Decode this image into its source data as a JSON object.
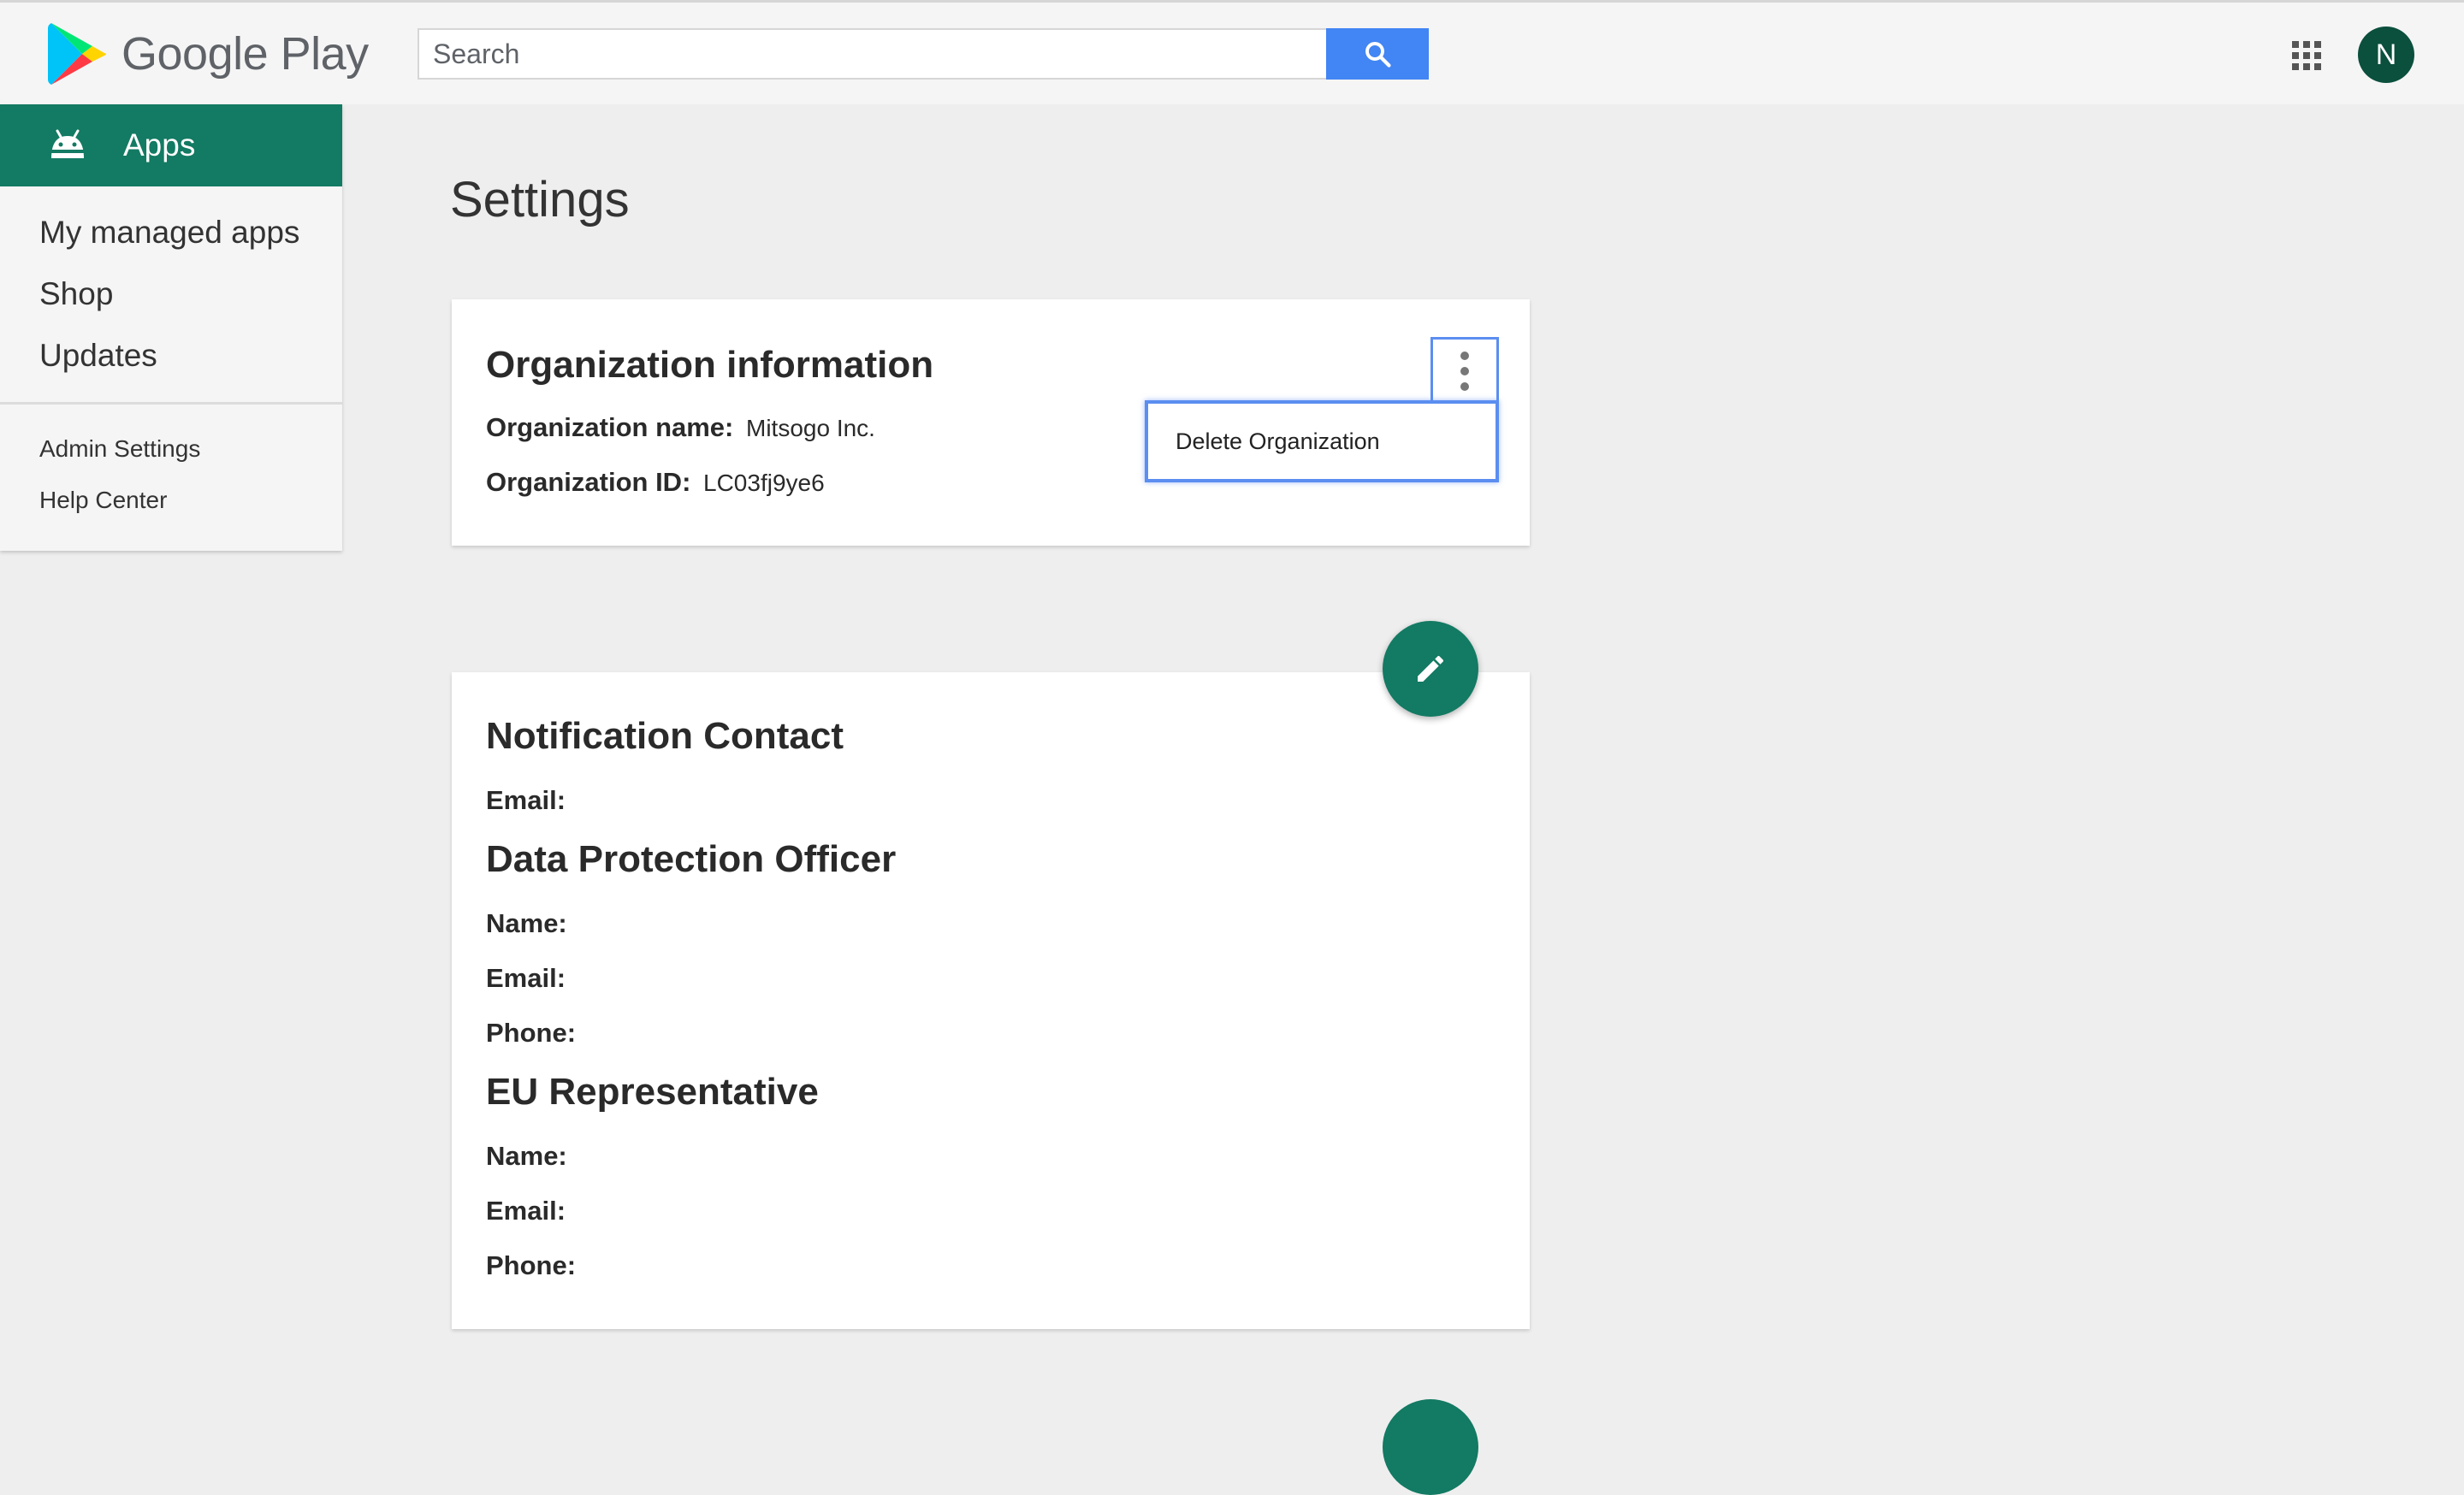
{
  "header": {
    "logo_text": "Google Play",
    "search_placeholder": "Search",
    "avatar_initial": "N"
  },
  "sidebar": {
    "section_label": "Apps",
    "nav_items": [
      "My managed apps",
      "Shop",
      "Updates"
    ],
    "secondary_items": [
      "Admin Settings",
      "Help Center"
    ]
  },
  "main": {
    "page_title": "Settings",
    "org_card": {
      "title": "Organization information",
      "name_label": "Organization name:",
      "name_value": "Mitsogo Inc.",
      "id_label": "Organization ID:",
      "id_value": "LC03fj9ye6"
    },
    "menu": {
      "delete_label": "Delete Organization"
    },
    "contact_card": {
      "notification_title": "Notification Contact",
      "notification_email_label": "Email:",
      "dpo_title": "Data Protection Officer",
      "dpo_name_label": "Name:",
      "dpo_email_label": "Email:",
      "dpo_phone_label": "Phone:",
      "eu_title": "EU Representative",
      "eu_name_label": "Name:",
      "eu_email_label": "Email:",
      "eu_phone_label": "Phone:"
    }
  },
  "icons": {
    "logo": "google-play-logo-icon",
    "search": "search-icon",
    "apps_grid": "apps-grid-icon",
    "android": "android-icon",
    "more": "more-vert-icon",
    "edit": "edit-pencil-icon"
  },
  "colors": {
    "accent_green": "#137a63",
    "search_blue": "#4285f4",
    "avatar_bg": "#0b4f3d",
    "focus_blue": "#5b8ef0"
  }
}
